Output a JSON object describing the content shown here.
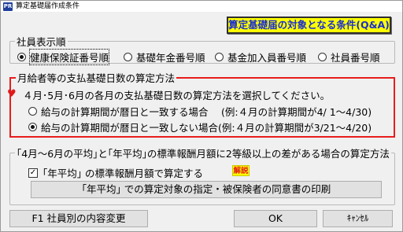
{
  "window": {
    "app_icon_text": "PR",
    "title": "算定基礎届作成条件"
  },
  "qa_button": {
    "label": "算定基礎届の対象となる条件(Q&A)"
  },
  "employee_order": {
    "legend": "社員表示順",
    "options": [
      {
        "label": "健康保険証番号順",
        "checked": true
      },
      {
        "label": "基礎年金番号順",
        "checked": false
      },
      {
        "label": "基金加入員番号順",
        "checked": false
      },
      {
        "label": "社員番号順",
        "checked": false
      }
    ]
  },
  "payment_days": {
    "legend": "月給者等の支払基礎日数の算定方法",
    "instruction": "４月･5月･6月の各月の支払基礎日数の算定方法を選択してください。",
    "options": [
      {
        "label": "給与の計算期間が暦日と一致する場合 　(例:４月の計算期間が4/ 1〜4/30)",
        "checked": false
      },
      {
        "label": "給与の計算期間が暦日と一致しない場合(例:４月の計算期間が3/21〜4/20)",
        "checked": true
      }
    ]
  },
  "average": {
    "legend": "｢4月〜6月の平均｣と｢年平均｣の標準報酬月額に2等級以上の差がある場合の算定方法",
    "checkbox_label": "｢年平均｣ の標準報酬月額で算定する",
    "checkbox_checked": true,
    "help_badge": "解説",
    "print_button": "｢年平均｣ での算定対象の指定・被保険者の同意書の印刷"
  },
  "footer": {
    "f1_button": "F1 社員別の内容変更",
    "ok_button": "OK",
    "cancel_button": "ｷｬﾝｾﾙ"
  }
}
